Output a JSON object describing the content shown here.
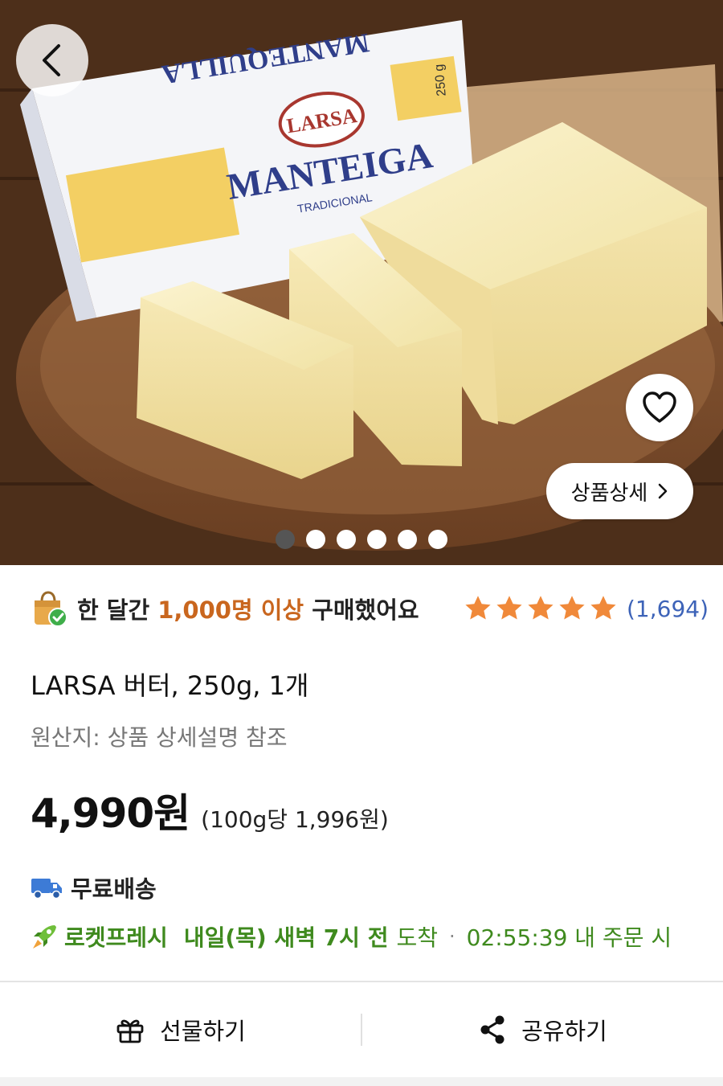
{
  "hero": {
    "detail_button_label": "상품상세",
    "image_count": 6,
    "active_index": 0,
    "package_brand": "LARSA",
    "package_name": "MANTEIGA",
    "package_sub": "TRADICIONAL",
    "package_top": "MANTEQUILLA",
    "package_weight": "250 g"
  },
  "purchase": {
    "prefix": "한 달간 ",
    "highlight": "1,000명 이상",
    "suffix": " 구매했어요",
    "rating_stars": 5,
    "review_count": "(1,694)"
  },
  "product": {
    "name": "LARSA 버터, 250g, 1개",
    "origin": "원산지: 상품 상세설명 참조",
    "price": "4,990원",
    "unit_price": "(100g당 1,996원)"
  },
  "shipping": {
    "free_label": "무료배송",
    "rocket_label": "로켓프레시",
    "arrival_bold": "내일(목) 새벽 7시 전",
    "arrival_rest": "도착",
    "separator": "·",
    "deadline": "02:55:39 내 주문 시"
  },
  "actions": {
    "gift_label": "선물하기",
    "share_label": "공유하기"
  },
  "colors": {
    "highlight": "#c9661e",
    "star": "#f0893a",
    "review": "#3d63b8",
    "rocket_green": "#3f8a1e"
  }
}
